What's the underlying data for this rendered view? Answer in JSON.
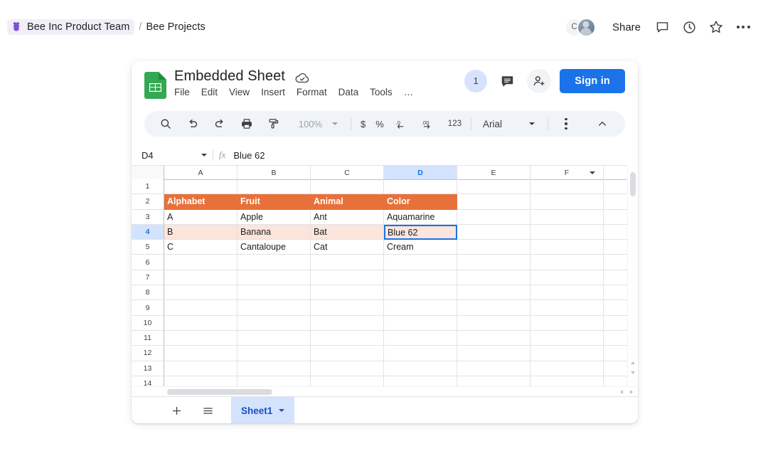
{
  "topbar": {
    "team": "Bee Inc Product Team",
    "separator": "/",
    "project": "Bee Projects",
    "avatar_initial": "C",
    "share_label": "Share",
    "icons": [
      "bee-icon",
      "comment-icon",
      "history-clock-icon",
      "star-icon",
      "overflow-menu-icon"
    ]
  },
  "sheet": {
    "title": "Embedded Sheet",
    "save_state_icon": "cloud-saved-icon",
    "menus": [
      "File",
      "Edit",
      "View",
      "Insert",
      "Format",
      "Data",
      "Tools"
    ],
    "menu_overflow": "…",
    "notification_count": "1",
    "sign_in_label": "Sign in",
    "toolbar": {
      "zoom": "100%",
      "currency": "$",
      "percent": "%",
      "decimal_decrease": ".0",
      "decimal_increase": ".00",
      "number_format": "123",
      "font": "Arial"
    },
    "formula_bar": {
      "name_box": "D4",
      "fx_label": "fx",
      "value": "Blue 62"
    },
    "grid": {
      "columns": [
        "A",
        "B",
        "C",
        "D",
        "E",
        "F"
      ],
      "selected_column": "D",
      "selected_row": "4",
      "rows": [
        "1",
        "2",
        "3",
        "4",
        "5",
        "6",
        "7",
        "8",
        "9",
        "10",
        "11",
        "12",
        "13",
        "14"
      ],
      "cells": {
        "2": [
          "Alphabet",
          "Fruit",
          "Animal",
          "Color"
        ],
        "3": [
          "A",
          "Apple",
          "Ant",
          "Aquamarine"
        ],
        "4": [
          "B",
          "Banana",
          "Bat",
          "Blue 62"
        ],
        "5": [
          "C",
          "Cantaloupe",
          "Cat",
          "Cream"
        ]
      },
      "header_fill": "#e8703a",
      "band_fill": "#fbe5dc",
      "selection_color": "#1a73e8"
    },
    "sheet_tabs": {
      "add_label": "+",
      "all_sheets_label": "all-sheets",
      "active_tab": "Sheet1"
    }
  }
}
